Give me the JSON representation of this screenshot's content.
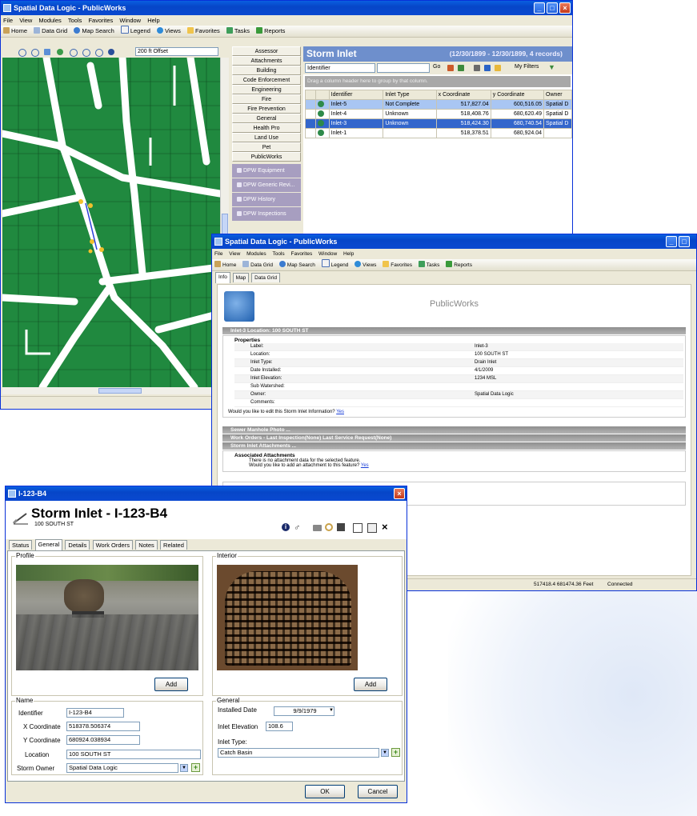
{
  "main_window": {
    "title": "Spatial Data Logic - PublicWorks",
    "menu": [
      "File",
      "View",
      "Modules",
      "Tools",
      "Favorites",
      "Window",
      "Help"
    ],
    "toolbar": [
      "Home",
      "Data Grid",
      "Map Search",
      "Legend",
      "Views",
      "Favorites",
      "Tasks",
      "Reports"
    ],
    "map_offset": "200 ft Offset",
    "modules": [
      "Assessor",
      "Attachments",
      "Building",
      "Code Enforcement",
      "Engineering",
      "Fire",
      "Fire Prevention",
      "General",
      "Health Pro",
      "Land Use",
      "Pet",
      "PublicWorks"
    ],
    "sub_modules": [
      "DPW Equipment",
      "DPW Generic Revi...",
      "DPW History",
      "DPW Inspections"
    ],
    "grid": {
      "title": "Storm Inlet",
      "range": "(12/30/1899 - 12/30/1899, 4 records)",
      "search_field": "Identifier",
      "go_label": "Go",
      "my_filters": "My Filters",
      "group_hint": "Drag a column header here to group by that column.",
      "columns": [
        "Identifier",
        "Inlet Type",
        "x Coordinate",
        "y Coordinate",
        "Owner"
      ],
      "rows": [
        [
          "Inlet-5",
          "Not Complete",
          "517,827.04",
          "600,516.05",
          "Spatial D"
        ],
        [
          "Inlet-4",
          "Unknown",
          "518,408.76",
          "680,620.49",
          "Spatial D"
        ],
        [
          "Inlet-3",
          "Unknown",
          "518,424.30",
          "680,740.54",
          "Spatial D"
        ],
        [
          "Inlet-1",
          "",
          "518,378.51",
          "680,924.04",
          ""
        ]
      ]
    }
  },
  "info_window": {
    "title": "Spatial Data Logic - PublicWorks",
    "menu": [
      "File",
      "View",
      "Modules",
      "Tools",
      "Favorites",
      "Window",
      "Help"
    ],
    "toolbar": [
      "Home",
      "Data Grid",
      "Map Search",
      "Legend",
      "Views",
      "Favorites",
      "Tasks",
      "Reports"
    ],
    "tabs": [
      "Info",
      "Map",
      "Data Grid"
    ],
    "heading": "PublicWorks",
    "section1": "Inlet-3 Location: 100 SOUTH ST",
    "properties_label": "Properties",
    "properties": [
      {
        "k": "Label:",
        "v": "Inlet-3"
      },
      {
        "k": "Location:",
        "v": "100 SOUTH ST"
      },
      {
        "k": "Inlet Type:",
        "v": "Drain Inlet"
      },
      {
        "k": "Date Installed:",
        "v": "4/1/2009"
      },
      {
        "k": "Inlet Elevation:",
        "v": "1234 MSL"
      },
      {
        "k": "Sub Watershed:",
        "v": ""
      },
      {
        "k": "Owner:",
        "v": "Spatial Data Logic"
      },
      {
        "k": "Comments:",
        "v": ""
      }
    ],
    "edit_prompt": "Would you like to edit this Storm Inlet Information?",
    "yes": "Yes",
    "section2": "Sewer Manhole Photo ...",
    "section3": "Work Orders - Last Inspection(None) Last Service Request(None)",
    "section4": "Storm Inlet Attachments ...",
    "attachments_label": "Associated Attachments",
    "no_attach": "There is no attachment data for the selected feature.",
    "add_attach_prompt": "Would you like to add an attachment to this feature?",
    "status_coords": "517418.4 681474.36 Feet",
    "status_conn": "Connected"
  },
  "form": {
    "title": "I-123-B4",
    "heading": "Storm Inlet - I-123-B4",
    "subheading": "100 SOUTH ST",
    "tabs": [
      "Status",
      "General",
      "Details",
      "Work Orders",
      "Notes",
      "Related"
    ],
    "profile_label": "Profile",
    "interior_label": "Interior",
    "add_label": "Add",
    "name_group": "Name",
    "general_group": "General",
    "identifier_label": "Identifier",
    "identifier": "I-123-B4",
    "x_label": "X Coordinate",
    "x": "518378.506374",
    "y_label": "Y Coordinate",
    "y": "680924.038934",
    "location_label": "Location",
    "location": "100 SOUTH ST",
    "owner_label": "Storm Owner",
    "owner": "Spatial Data Logic",
    "installed_label": "Installed Date",
    "installed": "9/9/1979",
    "elev_label": "Inlet Elevation",
    "elev": "108.6",
    "inlet_type_label": "Inlet Type:",
    "inlet_type": "Catch Basin",
    "ok": "OK",
    "cancel": "Cancel"
  }
}
